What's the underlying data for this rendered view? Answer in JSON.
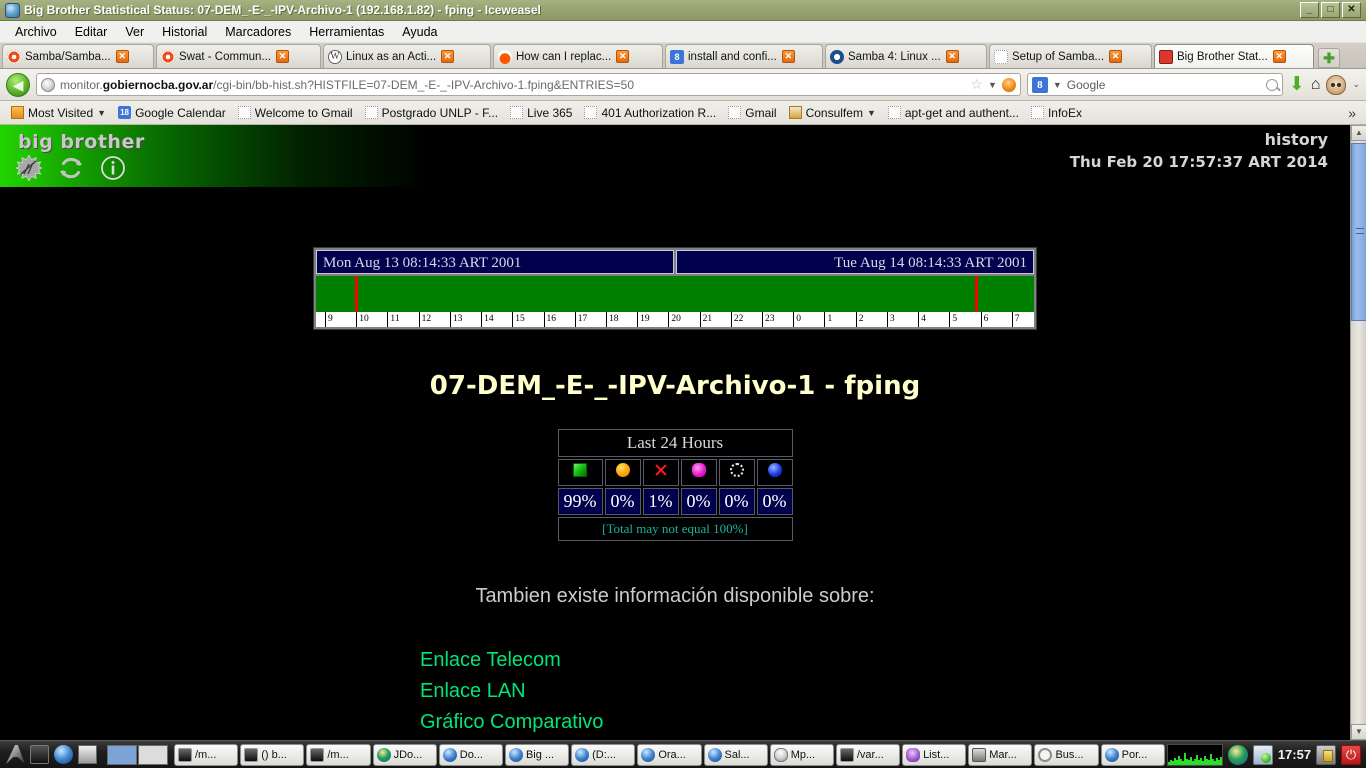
{
  "window": {
    "title": "Big Brother Statistical Status: 07-DEM_-E-_-IPV-Archivo-1 (192.168.1.82) - fping - Iceweasel",
    "minimize": "_",
    "maximize": "□",
    "close": "✕"
  },
  "menu": [
    "Archivo",
    "Editar",
    "Ver",
    "Historial",
    "Marcadores",
    "Herramientas",
    "Ayuda"
  ],
  "tabs": [
    {
      "label": "Samba/Samba...",
      "icon": "ring-icon",
      "active": false
    },
    {
      "label": "Swat - Commun...",
      "icon": "ring-icon",
      "active": false
    },
    {
      "label": "Linux as an Acti...",
      "icon": "wordpress-icon",
      "active": false
    },
    {
      "label": "How can I replac...",
      "icon": "reddit-icon",
      "active": false
    },
    {
      "label": "install and confi...",
      "icon": "blue-g-icon",
      "active": false
    },
    {
      "label": "Samba 4: Linux ...",
      "icon": "samba4-icon",
      "active": false
    },
    {
      "label": "Setup of Samba...",
      "icon": "blank-page-icon",
      "active": false
    },
    {
      "label": "Big Brother Stat...",
      "icon": "bigbrother-icon",
      "active": true
    }
  ],
  "tab_close_glyph": "✕",
  "tab_new_glyph": "✚",
  "nav": {
    "back_glyph": "◀",
    "url_prefix": "monitor.",
    "url_domain": "gobiernocba.gov.ar",
    "url_suffix": "/cgi-bin/bb-hist.sh?HISTFILE=07-DEM_-E-_-IPV-Archivo-1.fping&ENTRIES=50",
    "star_glyph": "☆",
    "chevron_glyph": "▼",
    "search_engine": "8",
    "search_placeholder": "Google",
    "download_glyph": "⬇",
    "home_glyph": "⌂",
    "overflow_glyph": "⌄"
  },
  "bookmarks": [
    {
      "label": "Most Visited",
      "icon": "folder-icon",
      "caret": true
    },
    {
      "label": "Google Calendar",
      "icon": "calendar-icon",
      "badge": "18",
      "caret": false
    },
    {
      "label": "Welcome to Gmail",
      "icon": "blank-page-icon",
      "caret": false
    },
    {
      "label": "Postgrado UNLP - F...",
      "icon": "blank-page-icon",
      "caret": false
    },
    {
      "label": "Live 365",
      "icon": "blank-page-icon",
      "caret": false
    },
    {
      "label": "401 Authorization R...",
      "icon": "blank-page-icon",
      "caret": false
    },
    {
      "label": "Gmail",
      "icon": "blank-page-icon",
      "caret": false
    },
    {
      "label": "Consulfem",
      "icon": "beer-icon",
      "caret": true
    },
    {
      "label": "apt-get and authent...",
      "icon": "blank-page-icon",
      "caret": false
    },
    {
      "label": "InfoEx",
      "icon": "blank-page-icon",
      "caret": false
    }
  ],
  "bookmarks_overflow": "»",
  "page": {
    "brand": "big brother",
    "brand_icons": [
      "burst-icon",
      "refresh-icon",
      "info-icon"
    ],
    "history_label": "history",
    "timestamp": "Thu Feb 20 17:57:37 ART 2014",
    "title": "07-DEM_-E-_-IPV-Archivo-1 - fping",
    "strip": {
      "start_label": "Mon Aug 13 08:14:33 ART 2001",
      "end_label": "Tue Aug 14 08:14:33 ART 2001",
      "bar_color": "#008000",
      "marker_color": "#ff0000",
      "markers_pct": [
        5.4,
        91.8
      ],
      "hour_ticks": [
        "9",
        "10",
        "11",
        "12",
        "13",
        "14",
        "15",
        "16",
        "17",
        "18",
        "19",
        "20",
        "21",
        "22",
        "23",
        "0",
        "1",
        "2",
        "3",
        "4",
        "5",
        "6",
        "7"
      ]
    },
    "stats": {
      "header": "Last 24 Hours",
      "icons": [
        "green-square-icon",
        "yellow-ball-icon",
        "red-x-icon",
        "purple-ball-icon",
        "clear-circle-icon",
        "blue-ball-icon"
      ],
      "values": [
        "99%",
        "0%",
        "1%",
        "0%",
        "0%",
        "0%"
      ],
      "footer": "[Total may not equal 100%]"
    },
    "also_text": "Tambien existe información disponible sobre:",
    "links": [
      "Enlace Telecom",
      "Enlace LAN",
      "Gráfico Comparativo"
    ]
  },
  "taskbar": {
    "items": [
      {
        "label": "/m...",
        "icon": "terminal-icon"
      },
      {
        "label": "() b...",
        "icon": "terminal-icon"
      },
      {
        "label": "/m...",
        "icon": "terminal-icon"
      },
      {
        "label": "JDo...",
        "icon": "jdownloader-icon"
      },
      {
        "label": "Do...",
        "icon": "iceweasel-icon"
      },
      {
        "label": "Big ...",
        "icon": "iceweasel-icon"
      },
      {
        "label": "(D:...",
        "icon": "iceweasel-icon"
      },
      {
        "label": "Ora...",
        "icon": "iceweasel-icon"
      },
      {
        "label": "Sal...",
        "icon": "iceweasel-icon"
      },
      {
        "label": "Mp...",
        "icon": "mouse-icon"
      },
      {
        "label": "/var...",
        "icon": "terminal-icon"
      },
      {
        "label": "List...",
        "icon": "bird-icon"
      },
      {
        "label": "Mar...",
        "icon": "image-icon"
      },
      {
        "label": "Bus...",
        "icon": "magnifier-icon"
      },
      {
        "label": "Por...",
        "icon": "iceweasel-icon"
      }
    ],
    "clock": "17:57",
    "tray_icons": [
      "system-monitor-graph",
      "jdownloader-tray-icon",
      "messenger-icon",
      "lock-screen-icon",
      "power-icon"
    ],
    "power_glyph": "⏻"
  }
}
